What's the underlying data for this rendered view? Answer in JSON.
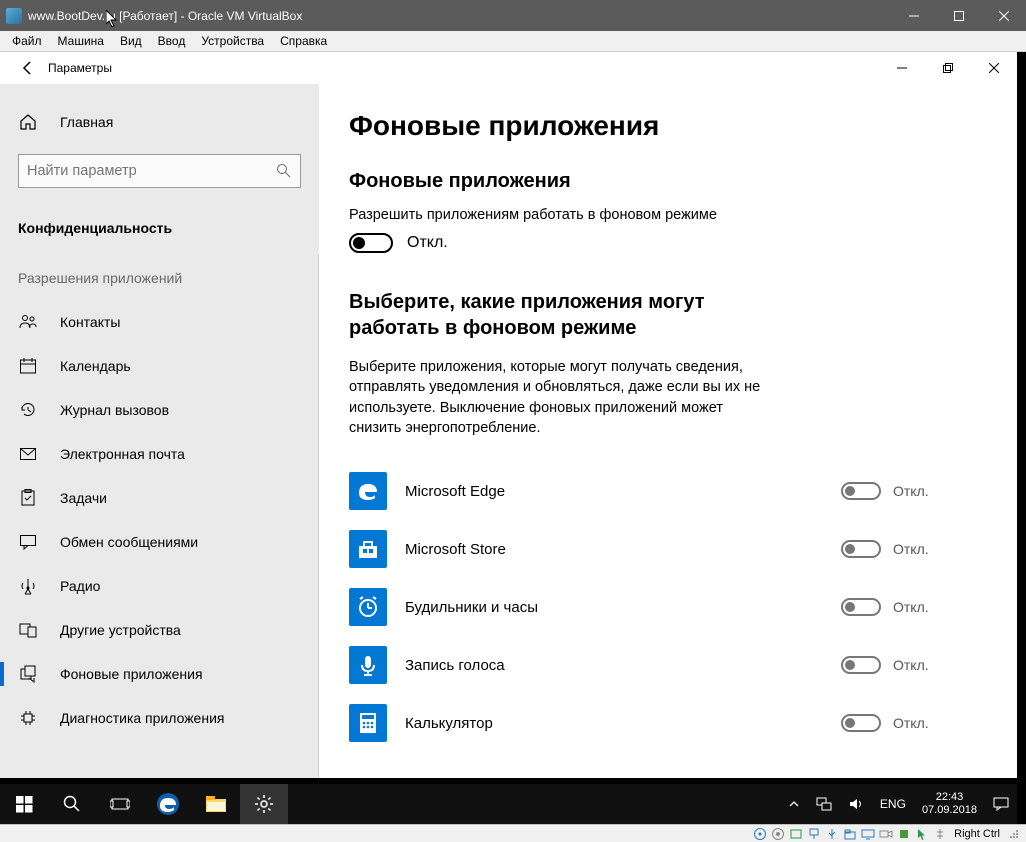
{
  "vbox": {
    "title": "www.BootDev.ru [Работает] - Oracle VM VirtualBox",
    "menu": [
      "Файл",
      "Машина",
      "Вид",
      "Ввод",
      "Устройства",
      "Справка"
    ],
    "hostkey": "Right Ctrl"
  },
  "settings": {
    "header": "Параметры",
    "home": "Главная",
    "search_placeholder": "Найти параметр",
    "category": "Конфиденциальность",
    "subsection": "Разрешения приложений",
    "nav": [
      {
        "icon": "contacts",
        "label": "Контакты"
      },
      {
        "icon": "calendar",
        "label": "Календарь"
      },
      {
        "icon": "history",
        "label": "Журнал вызовов"
      },
      {
        "icon": "mail",
        "label": "Электронная почта"
      },
      {
        "icon": "tasks",
        "label": "Задачи"
      },
      {
        "icon": "message",
        "label": "Обмен сообщениями"
      },
      {
        "icon": "radio",
        "label": "Радио"
      },
      {
        "icon": "devices",
        "label": "Другие устройства"
      },
      {
        "icon": "background",
        "label": "Фоновые приложения",
        "selected": true
      },
      {
        "icon": "diagnostics",
        "label": "Диагностика приложения"
      }
    ]
  },
  "content": {
    "title": "Фоновые приложения",
    "section1_title": "Фоновые приложения",
    "section1_text": "Разрешить приложениям работать в фоновом режиме",
    "off_label": "Откл.",
    "section2_title": "Выберите, какие приложения могут работать в фоновом режиме",
    "section2_desc": "Выберите приложения, которые могут получать сведения, отправлять уведомления и обновляться, даже если вы их не используете. Выключение фоновых приложений может снизить энергопотребление.",
    "apps": [
      {
        "name": "Microsoft Edge",
        "state": "Откл.",
        "icon": "edge"
      },
      {
        "name": "Microsoft Store",
        "state": "Откл.",
        "icon": "store"
      },
      {
        "name": "Будильники и часы",
        "state": "Откл.",
        "icon": "alarm"
      },
      {
        "name": "Запись голоса",
        "state": "Откл.",
        "icon": "voice"
      },
      {
        "name": "Калькулятор",
        "state": "Откл.",
        "icon": "calculator"
      }
    ]
  },
  "taskbar": {
    "lang": "ENG",
    "time": "22:43",
    "date": "07.09.2018"
  }
}
